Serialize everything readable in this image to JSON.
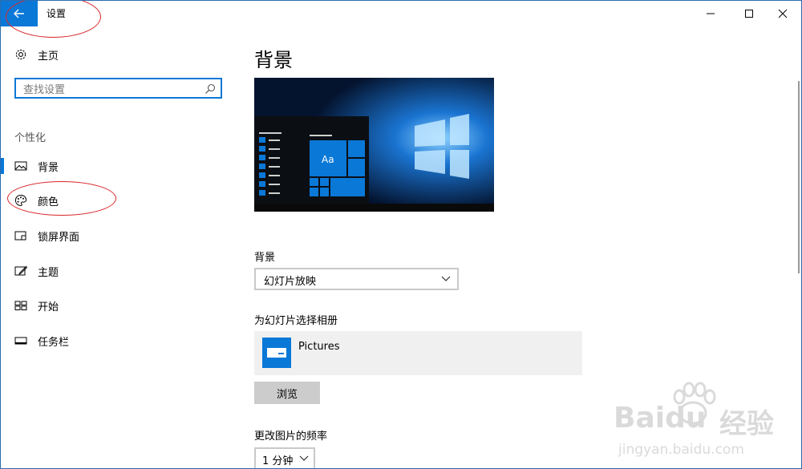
{
  "window": {
    "title": "设置"
  },
  "sidebar": {
    "home_label": "主页",
    "search_placeholder": "查找设置",
    "group_label": "个性化",
    "items": [
      {
        "label": "背景",
        "icon": "picture-icon",
        "selected": true
      },
      {
        "label": "颜色",
        "icon": "palette-icon",
        "selected": false
      },
      {
        "label": "锁屏界面",
        "icon": "lock-screen-icon",
        "selected": false
      },
      {
        "label": "主题",
        "icon": "theme-icon",
        "selected": false
      },
      {
        "label": "开始",
        "icon": "start-icon",
        "selected": false
      },
      {
        "label": "任务栏",
        "icon": "taskbar-icon",
        "selected": false
      }
    ]
  },
  "main": {
    "page_title": "背景",
    "preview": {
      "tile_text": "Aa"
    },
    "background": {
      "label": "背景",
      "value": "幻灯片放映"
    },
    "album": {
      "label": "为幻灯片选择相册",
      "name": "Pictures",
      "browse_label": "浏览"
    },
    "frequency": {
      "label": "更改图片的频率",
      "value": "1 分钟"
    }
  },
  "watermark": {
    "brand": "Baidu",
    "brand_cn": "经验",
    "url": "jingyan.baidu.com"
  },
  "colors": {
    "accent": "#0a78d7",
    "annotation": "#d9272a",
    "tile_bg": "#f0f0f0",
    "button_bg": "#cccccc"
  }
}
